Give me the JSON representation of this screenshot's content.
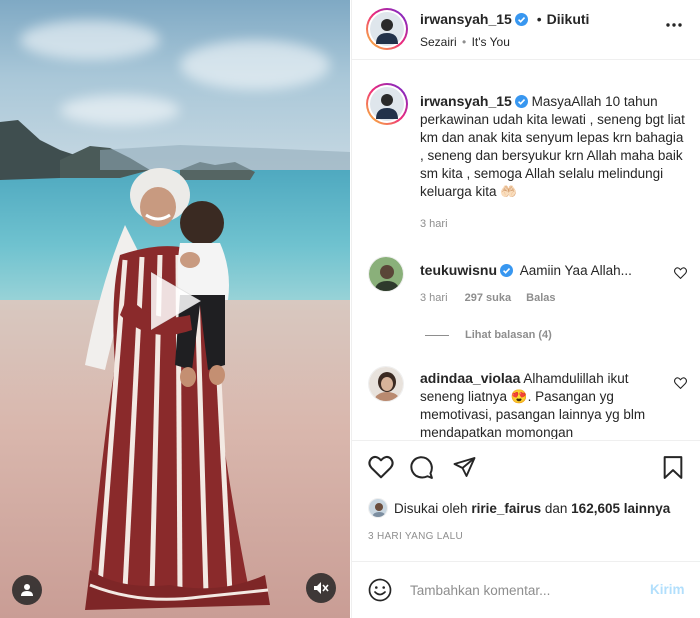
{
  "post": {
    "author": "irwansyah_15",
    "follow_status": "Diikuti",
    "separator": "•",
    "audio": {
      "artist": "Sezairi",
      "separator": "•",
      "track": "It's You"
    },
    "caption": "MasyaAllah 10 tahun perkawinan udah kita lewati , seneng bgt liat km dan anak kita senyum lepas krn bahagia , seneng dan bersyukur krn Allah maha baik sm kita , semoga Allah selalu melindungi keluarga kita 🤲🏻",
    "caption_time": "3 hari",
    "liked_by_prefix": "Disukai oleh",
    "liked_by_user": "ririe_fairus",
    "liked_by_join": "dan",
    "liked_by_count": "162,605 lainnya",
    "posted_ago": "3 HARI YANG LALU"
  },
  "comments": [
    {
      "username": "teukuwisnu",
      "text": "Aamiin Yaa Allah...",
      "time": "3 hari",
      "likes": "297 suka",
      "reply_label": "Balas",
      "view_replies": "Lihat balasan (4)"
    },
    {
      "username": "adindaa_violaa",
      "text": "Alhamdulillah ikut seneng liatnya 😍. Pasangan yg memotivasi, pasangan lainnya yg blm mendapatkan momongan"
    }
  ],
  "comment_box": {
    "placeholder": "Tambahkan komentar...",
    "post_label": "Kirim"
  },
  "icons": {
    "more": "more-horizontal-icon",
    "like": "heart-icon",
    "comment": "comment-bubble-icon",
    "share": "paper-plane-icon",
    "save": "bookmark-icon",
    "play": "play-icon",
    "tag": "user-tag-icon",
    "mute": "speaker-muted-icon",
    "emoji": "smiley-icon",
    "verified": "verified-badge-icon"
  },
  "colors": {
    "verified": "#3897f0",
    "post_button_disabled": "#b2dffc",
    "muted_text": "#8e8e8e"
  }
}
